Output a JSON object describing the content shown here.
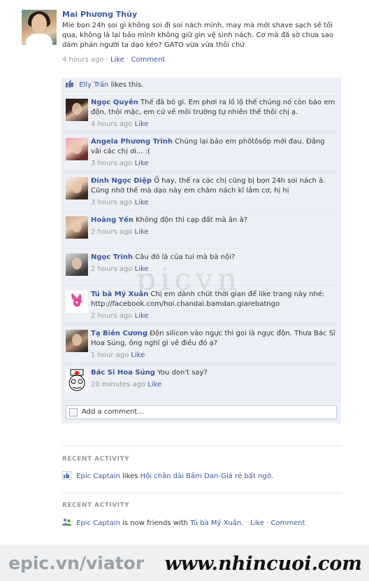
{
  "post": {
    "author": "Mai Phương Thủy",
    "text": "Mie bọn 24h soi gì không soi đi soi nách mình, may mà mới shave sạch sẽ tối qua, không là lại bảo mình không giữ gìn vệ sinh nách. Cơ mà đã sờ chưa sao dám phán người ta dạo kéo? GATO vừa vừa thôi chứ",
    "time": "4 hours ago",
    "like": "Like",
    "comment": "Comment"
  },
  "likes": {
    "who": "Elly Trần",
    "text": "likes this."
  },
  "comments": [
    {
      "name": "Ngọc Quyên",
      "text": "Thế đã bõ gì. Em phơi ra lồ lộ thế chúng nó còn bảo em độn, thôi mặc, em cứ về môi trường tự nhiên thế thôi chị ạ.",
      "time": "4 hours ago",
      "like": "Like",
      "avatar": "dark"
    },
    {
      "name": "Angela Phương Trinh",
      "text": "Chúng lại bảo em phôtôsốp mới đau. Đắng vãi các chị ơi... :(",
      "time": "3 hours ago",
      "like": "Like",
      "avatar": "pink"
    },
    {
      "name": "Đinh Ngọc Diệp",
      "text": "Ồ hay, thế ra các chị cũng bị bọn 24h soi nách à. Cũng nhờ thế mà dạo này em chăm nách kĩ lắm cơ, hị hị",
      "time": "3 hours ago",
      "like": "Like",
      "avatar": "light"
    },
    {
      "name": "Hoàng Yến",
      "text": "Không độn thì cạp đất mà ăn à?",
      "time": "2 hours ago",
      "like": "Like",
      "avatar": "tan"
    },
    {
      "name": "Ngọc Trinh",
      "text": "Câu đó là của tui mà bà nội?",
      "time": "2 hours ago",
      "like": "Like",
      "avatar": "mono"
    },
    {
      "name": "Tú bà Mỹ Xuân",
      "text": "Chị em dành chút thời gian để like trang này nhé: http://facebook.com/hoi.chandai.bamdan.giarebatngo",
      "time": "2 hours ago",
      "like": "Like",
      "avatar": "bunny"
    },
    {
      "name": "Tạ Biên Cương",
      "text": "Độn silicon vào ngực thì gọi là ngực độn. Thưa Bác Sĩ Hoa Súng, ông nghĩ gì về điều đó ạ?",
      "time": "1 hour ago",
      "like": "Like",
      "avatar": "man"
    },
    {
      "name": "Bác Sĩ Hoa Súng",
      "text": "You don't say?",
      "time": "20 minutes ago",
      "like": "Like",
      "avatar": "meme"
    }
  ],
  "add_comment": "Add a comment...",
  "activity": [
    {
      "header": "RECENT ACTIVITY",
      "actor": "Epic Captain",
      "verb": "likes",
      "object": "Hội chân dài Bầm Dan-Giá rẻ bất ngờ.",
      "time": "",
      "like": "",
      "comment": ""
    },
    {
      "header": "RECENT ACTIVITY",
      "actor": "Epic Captain",
      "verb": "is now friends with",
      "object": "Tú bà Mỹ Xuân.",
      "time": "",
      "like": "Like",
      "comment": "Comment"
    }
  ],
  "watermarks": {
    "left": "epic.vn/viator",
    "right": "www.nhincuoi.com",
    "center": "picvn"
  },
  "colors": {
    "link": "#3b5998",
    "comment_bg": "#eceff5",
    "meta": "#999999"
  }
}
